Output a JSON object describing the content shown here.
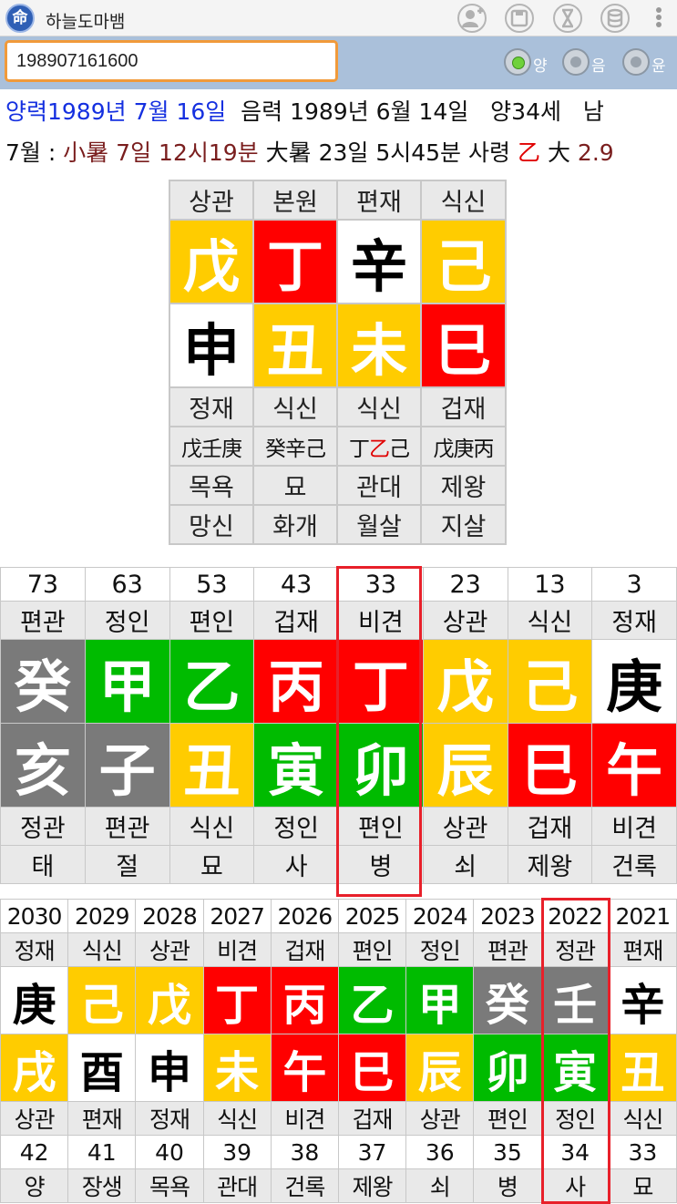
{
  "app": {
    "title": "하늘도마뱀",
    "icon_glyph": "命"
  },
  "toolbar": {
    "icons": [
      "add-person-icon",
      "save-icon",
      "hourglass-icon",
      "database-icon",
      "more-vert-icon"
    ]
  },
  "input": {
    "value": "198907161600"
  },
  "calendar_options": [
    {
      "label": "양",
      "selected": true
    },
    {
      "label": "음",
      "selected": false
    },
    {
      "label": "윤",
      "selected": false
    }
  ],
  "info": {
    "solar": "양력1989년 7월 16일",
    "lunar": "음력 1989년 6월 14일",
    "age": "양34세",
    "gender": "남",
    "month": "7월 :",
    "term1": "小暑 7일 12시19분",
    "term2": "大暑 23일 5시45분",
    "saryeong_label": "사령",
    "saryeong_char": "乙",
    "daeun_label": "大",
    "daeun_value": "2.9"
  },
  "natal": {
    "stem_gods": [
      "상관",
      "본원",
      "편재",
      "식신"
    ],
    "stems": [
      {
        "char": "戊",
        "color": "yellow"
      },
      {
        "char": "丁",
        "color": "red"
      },
      {
        "char": "辛",
        "color": "white"
      },
      {
        "char": "己",
        "color": "yellow"
      }
    ],
    "branches": [
      {
        "char": "申",
        "color": "white"
      },
      {
        "char": "丑",
        "color": "yellow"
      },
      {
        "char": "未",
        "color": "yellow"
      },
      {
        "char": "巳",
        "color": "red"
      }
    ],
    "branch_gods": [
      "정재",
      "식신",
      "식신",
      "겁재"
    ],
    "hidden_stems": [
      {
        "pre": "戊壬庚",
        "hl": "",
        "post": ""
      },
      {
        "pre": "癸辛己",
        "hl": "",
        "post": ""
      },
      {
        "pre": "丁",
        "hl": "乙",
        "post": "己"
      },
      {
        "pre": "戊庚丙",
        "hl": "",
        "post": ""
      }
    ],
    "stages": [
      "목욕",
      "묘",
      "관대",
      "제왕"
    ],
    "spirits": [
      "망신",
      "화개",
      "월살",
      "지살"
    ]
  },
  "daeun": {
    "highlight_index": 4,
    "ages": [
      "73",
      "63",
      "53",
      "43",
      "33",
      "23",
      "13",
      "3"
    ],
    "stem_gods": [
      "편관",
      "정인",
      "편인",
      "겁재",
      "비견",
      "상관",
      "식신",
      "정재"
    ],
    "stems": [
      {
        "char": "癸",
        "color": "gray"
      },
      {
        "char": "甲",
        "color": "green"
      },
      {
        "char": "乙",
        "color": "green"
      },
      {
        "char": "丙",
        "color": "red"
      },
      {
        "char": "丁",
        "color": "red"
      },
      {
        "char": "戊",
        "color": "yellow"
      },
      {
        "char": "己",
        "color": "yellow"
      },
      {
        "char": "庚",
        "color": "white"
      }
    ],
    "branches": [
      {
        "char": "亥",
        "color": "gray"
      },
      {
        "char": "子",
        "color": "gray"
      },
      {
        "char": "丑",
        "color": "yellow"
      },
      {
        "char": "寅",
        "color": "green"
      },
      {
        "char": "卯",
        "color": "green"
      },
      {
        "char": "辰",
        "color": "yellow"
      },
      {
        "char": "巳",
        "color": "red"
      },
      {
        "char": "午",
        "color": "red"
      }
    ],
    "branch_gods": [
      "정관",
      "편관",
      "식신",
      "정인",
      "편인",
      "상관",
      "겁재",
      "비견"
    ],
    "stages": [
      "태",
      "절",
      "묘",
      "사",
      "병",
      "쇠",
      "제왕",
      "건록"
    ]
  },
  "yearly": {
    "highlight_index": 8,
    "years": [
      "2030",
      "2029",
      "2028",
      "2027",
      "2026",
      "2025",
      "2024",
      "2023",
      "2022",
      "2021"
    ],
    "stem_gods": [
      "정재",
      "식신",
      "상관",
      "비견",
      "겁재",
      "편인",
      "정인",
      "편관",
      "정관",
      "편재"
    ],
    "stems": [
      {
        "char": "庚",
        "color": "white"
      },
      {
        "char": "己",
        "color": "yellow"
      },
      {
        "char": "戊",
        "color": "yellow"
      },
      {
        "char": "丁",
        "color": "red"
      },
      {
        "char": "丙",
        "color": "red"
      },
      {
        "char": "乙",
        "color": "green"
      },
      {
        "char": "甲",
        "color": "green"
      },
      {
        "char": "癸",
        "color": "gray"
      },
      {
        "char": "壬",
        "color": "gray"
      },
      {
        "char": "辛",
        "color": "white"
      }
    ],
    "branches": [
      {
        "char": "戌",
        "color": "yellow"
      },
      {
        "char": "酉",
        "color": "white"
      },
      {
        "char": "申",
        "color": "white"
      },
      {
        "char": "未",
        "color": "yellow"
      },
      {
        "char": "午",
        "color": "red"
      },
      {
        "char": "巳",
        "color": "red"
      },
      {
        "char": "辰",
        "color": "yellow"
      },
      {
        "char": "卯",
        "color": "green"
      },
      {
        "char": "寅",
        "color": "green"
      },
      {
        "char": "丑",
        "color": "yellow"
      }
    ],
    "branch_gods": [
      "상관",
      "편재",
      "정재",
      "식신",
      "비견",
      "겁재",
      "상관",
      "편인",
      "정인",
      "식신"
    ],
    "ages": [
      "42",
      "41",
      "40",
      "39",
      "38",
      "37",
      "36",
      "35",
      "34",
      "33"
    ],
    "stages": [
      "양",
      "장생",
      "목욕",
      "관대",
      "건록",
      "제왕",
      "쇠",
      "병",
      "사",
      "묘"
    ]
  }
}
